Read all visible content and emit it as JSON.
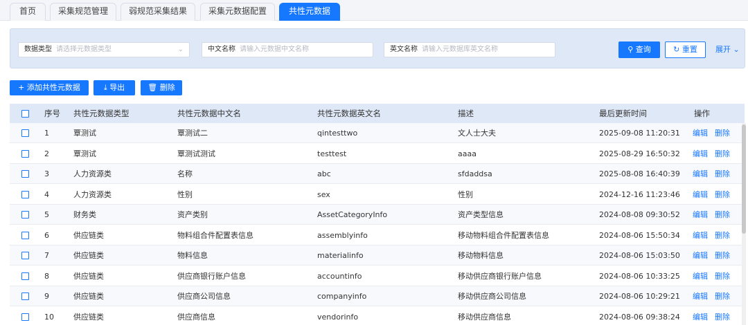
{
  "tabs": [
    "首页",
    "采集规范管理",
    "弱规范采集结果",
    "采集元数据配置",
    "共性元数据"
  ],
  "search": {
    "type_label": "数据类型",
    "type_placeholder": "请选择元数据类型",
    "cn_label": "中文名称",
    "cn_placeholder": "请输入元数据中文名称",
    "en_label": "英文名称",
    "en_placeholder": "请输入元数据库英文名称",
    "query_label": "查询",
    "reset_label": "重置",
    "expand_label": "展开"
  },
  "toolbar": {
    "add_label": "添加共性元数据",
    "export_label": "导出",
    "delete_label": "删除"
  },
  "table": {
    "headers": [
      "序号",
      "共性元数据类型",
      "共性元数据中文名",
      "共性元数据英文名",
      "描述",
      "最后更新时间",
      "操作"
    ],
    "action_edit": "编辑",
    "action_delete": "删除",
    "rows": [
      [
        "1",
        "覃测试",
        "覃测试二",
        "qintesttwo",
        "文人士大夫",
        "2025-09-08 11:20:31"
      ],
      [
        "2",
        "覃测试",
        "覃测试测试",
        "testtest",
        "aaaa",
        "2025-08-29 16:50:32"
      ],
      [
        "3",
        "人力资源类",
        "名称",
        "abc",
        "sfdaddsa",
        "2025-08-08 16:40:39"
      ],
      [
        "4",
        "人力资源类",
        "性别",
        "sex",
        "性别",
        "2024-12-16 11:23:46"
      ],
      [
        "5",
        "财务类",
        "资产类别",
        "AssetCategoryInfo",
        "资产类型信息",
        "2024-08-08 09:30:52"
      ],
      [
        "6",
        "供应链类",
        "物料组合件配置表信息",
        "assemblyinfo",
        "移动物料组合件配置表信息",
        "2024-08-06 15:50:34"
      ],
      [
        "7",
        "供应链类",
        "物料信息",
        "materialinfo",
        "移动物料信息",
        "2024-08-06 15:03:50"
      ],
      [
        "8",
        "供应链类",
        "供应商银行账户信息",
        "accountinfo",
        "移动供应商银行账户信息",
        "2024-08-06 10:33:25"
      ],
      [
        "9",
        "供应链类",
        "供应商公司信息",
        "companyinfo",
        "移动供应商公司信息",
        "2024-08-06 10:29:21"
      ],
      [
        "10",
        "供应链类",
        "供应商信息",
        "vendorinfo",
        "移动供应商信息",
        "2024-08-06 09:38:24"
      ]
    ]
  },
  "colors": {
    "primary": "#1677ff",
    "header_bg": "#dfe8f7"
  }
}
